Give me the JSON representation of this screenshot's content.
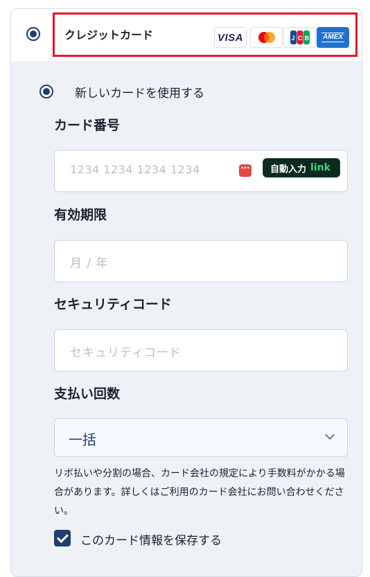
{
  "payment": {
    "credit_label": "クレジットカード",
    "brands": {
      "visa": "VISA",
      "mastercard": "Mastercard",
      "jcb": "JCB",
      "amex": "AMEX"
    },
    "new_card_label": "新しいカードを使用する"
  },
  "form": {
    "card_number_label": "カード番号",
    "card_number_placeholder": "1234 1234 1234 1234",
    "autofill_label": "自動入力",
    "autofill_link": "link",
    "expiry_label": "有効期限",
    "expiry_placeholder": "月 / 年",
    "security_label": "セキュリティコード",
    "security_placeholder": "セキュリティコード",
    "installments_label": "支払い回数",
    "installments_value": "一括",
    "note": "リボ払いや分割の場合、カード会社の規定により手数料がかかる場合があります。詳しくはご利用のカード会社にお問い合わせください。",
    "save_label": "このカード情報を保存する"
  },
  "colors": {
    "highlight": "#e01a2b",
    "accent": "#1f3d6e",
    "link_green": "#3fd07a"
  }
}
